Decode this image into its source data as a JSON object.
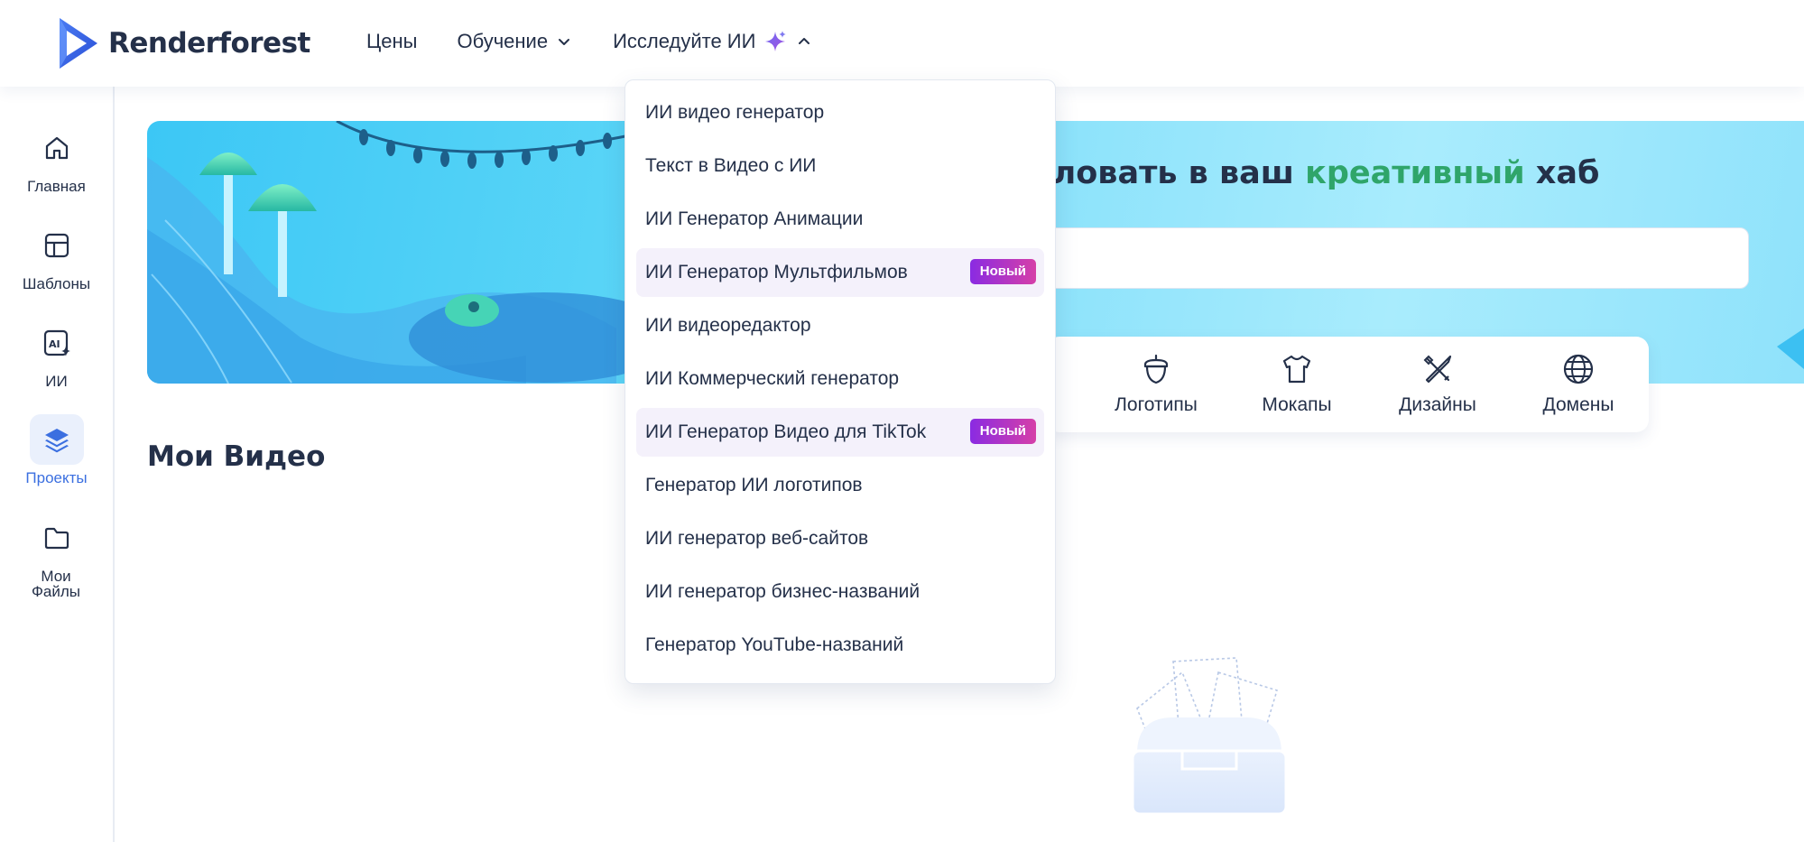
{
  "brand": {
    "name": "Renderforest"
  },
  "nav": {
    "pricing": "Цены",
    "learning": "Обучение",
    "explore_ai": "Исследуйте ИИ"
  },
  "sidebar": {
    "items": [
      {
        "label": "Главная",
        "icon": "home-icon",
        "active": false
      },
      {
        "label": "Шаблоны",
        "icon": "templates-icon",
        "active": false
      },
      {
        "label": "ИИ",
        "icon": "ai-icon",
        "active": false
      },
      {
        "label": "Проекты",
        "icon": "layers-icon",
        "active": true
      },
      {
        "label": "Мои Файлы",
        "icon": "folder-icon",
        "active": false
      }
    ]
  },
  "banner": {
    "title_prefix": "аловать в ваш ",
    "title_highlight": "креативный",
    "title_suffix": " хаб"
  },
  "categories": [
    {
      "label": "Логотипы",
      "icon": "acorn-icon"
    },
    {
      "label": "Мокапы",
      "icon": "tshirt-icon"
    },
    {
      "label": "Дизайны",
      "icon": "design-tools-icon"
    },
    {
      "label": "Домены",
      "icon": "globe-icon"
    }
  ],
  "main": {
    "section_title": "Мои Видео"
  },
  "dropdown": {
    "items": [
      {
        "label": "ИИ видео генератор",
        "badge": ""
      },
      {
        "label": "Текст в Видео с ИИ",
        "badge": ""
      },
      {
        "label": "ИИ Генератор Анимации",
        "badge": ""
      },
      {
        "label": "ИИ Генератор Мультфильмов",
        "badge": "Новый"
      },
      {
        "label": "ИИ видеоредактор",
        "badge": ""
      },
      {
        "label": "ИИ Коммерческий генератор",
        "badge": ""
      },
      {
        "label": "ИИ Генератор Видео для TikTok",
        "badge": "Новый"
      },
      {
        "label": "Генератор ИИ логотипов",
        "badge": ""
      },
      {
        "label": "ИИ генератор веб-сайтов",
        "badge": ""
      },
      {
        "label": "ИИ генератор бизнес-названий",
        "badge": ""
      },
      {
        "label": "Генератор YouTube-названий",
        "badge": ""
      }
    ]
  },
  "colors": {
    "accent_blue": "#3b6fe0",
    "highlight_green": "#2fa56a",
    "badge_gradient_start": "#8a2be2",
    "badge_gradient_end": "#d63fa8",
    "text_dark": "#243049"
  }
}
